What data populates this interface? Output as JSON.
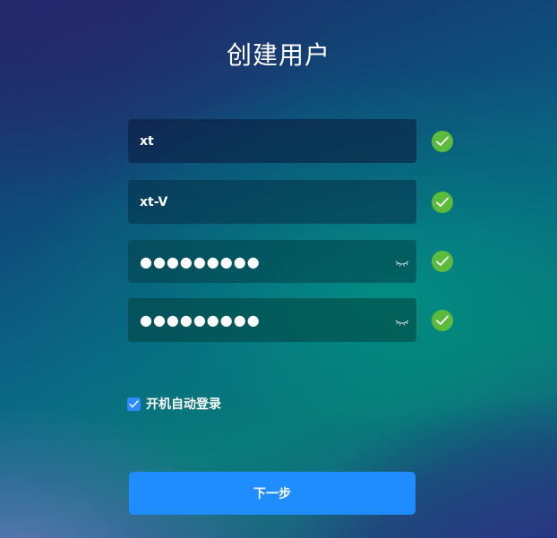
{
  "page": {
    "title": "创建用户"
  },
  "form": {
    "username_value": "xt",
    "fullname_value": "xt-V",
    "password_masked": "●●●●●●●●●",
    "confirm_password_masked": "●●●●●●●●●",
    "auto_login_label": "开机自动登录",
    "auto_login_checked": true
  },
  "actions": {
    "next_label": "下一步"
  },
  "colors": {
    "accent": "#1f8cff",
    "valid_check": "#5cba3c"
  },
  "icons": {
    "validation": "check-circle-icon",
    "password_visibility": "eye-closed-icon",
    "checkbox": "checkbox-checked-icon"
  }
}
